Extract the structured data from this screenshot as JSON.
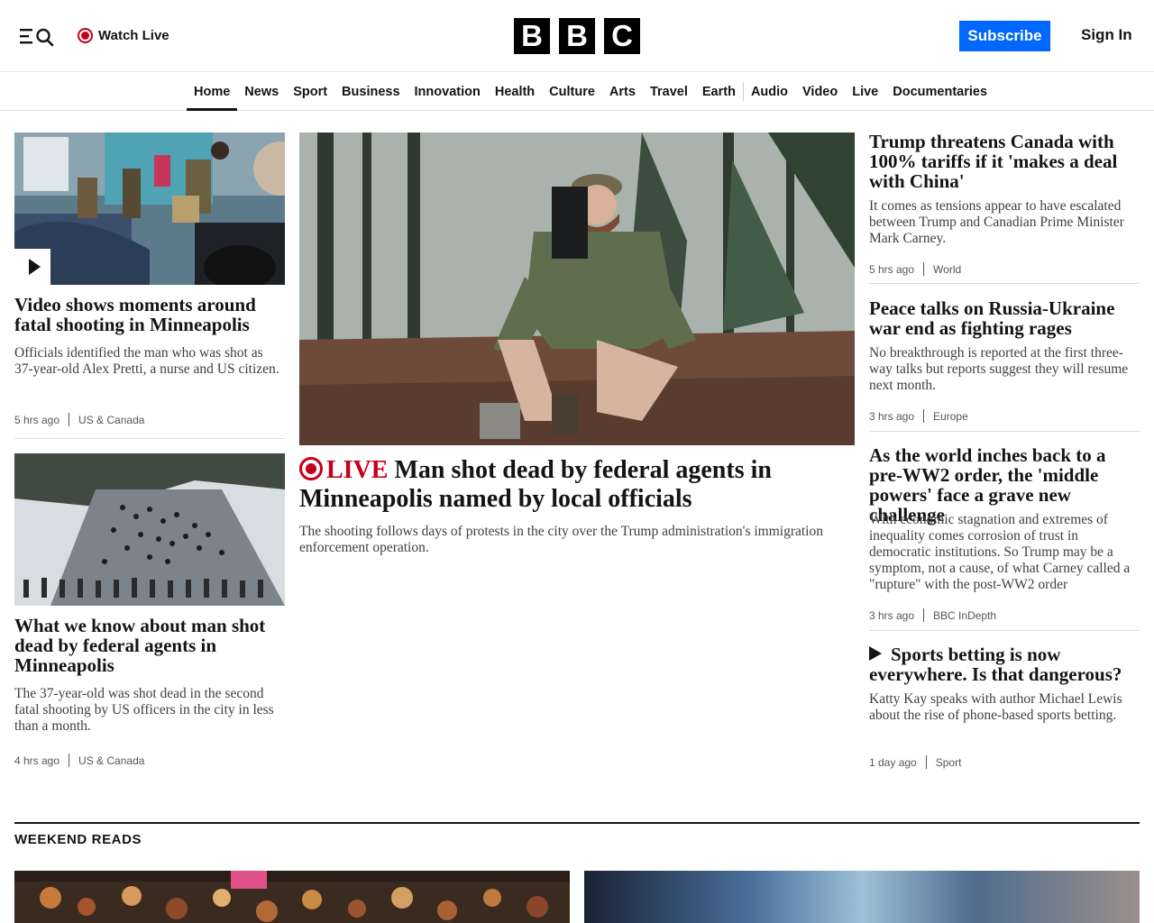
{
  "header": {
    "watch_live": "Watch Live",
    "logo_letters": [
      "B",
      "B",
      "C"
    ],
    "subscribe": "Subscribe",
    "sign_in": "Sign In"
  },
  "nav": {
    "items": [
      "Home",
      "News",
      "Sport",
      "Business",
      "Innovation",
      "Health",
      "Culture",
      "Arts",
      "Travel",
      "Earth",
      "Audio",
      "Video",
      "Live",
      "Documentaries"
    ],
    "active": "Home"
  },
  "left_stories": [
    {
      "headline": "Video shows moments around fatal shooting in Minneapolis",
      "summary": "Officials identified the man who was shot as 37-year-old Alex Pretti, a nurse and US citizen.",
      "time": "5 hrs ago",
      "section": "US & Canada"
    },
    {
      "headline": "What we know about man shot dead by federal agents in Minneapolis",
      "summary": "The 37-year-old was shot dead in the second fatal shooting by US officers in the city in less than a month.",
      "time": "4 hrs ago",
      "section": "US & Canada"
    }
  ],
  "lead_story": {
    "live_label": "LIVE",
    "headline": "Man shot dead by federal agents in Minneapolis named by local officials",
    "summary": "The shooting follows days of protests in the city over the Trump administration's immigration enforcement operation."
  },
  "right_stories": [
    {
      "headline": "Trump threatens Canada with 100% tariffs if it 'makes a deal with China'",
      "summary": "It comes as tensions appear to have escalated between Trump and Canadian Prime Minister Mark Carney.",
      "time": "5 hrs ago",
      "section": "World"
    },
    {
      "headline": "Peace talks on Russia-Ukraine war end as fighting rages",
      "summary": "No breakthrough is reported at the first three-way talks but reports suggest they will resume next month.",
      "time": "3 hrs ago",
      "section": "Europe"
    },
    {
      "headline": "As the world inches back to a pre-WW2 order, the 'middle powers' face a grave new challenge",
      "summary": "With economic stagnation and extremes of inequality comes corrosion of trust in democratic institutions. So Trump may be a symptom, not a cause, of what Carney called a \"rupture\" with the post-WW2 order",
      "time": "3 hrs ago",
      "section": "BBC InDepth"
    },
    {
      "headline": "Sports betting is now everywhere. Is that dangerous?",
      "summary": "Katty Kay speaks with author Michael Lewis about the rise of phone-based sports betting.",
      "time": "1 day ago",
      "section": "Sport"
    }
  ],
  "weekend": {
    "title": "WEEKEND READS"
  },
  "colors": {
    "live_red": "#c4001a",
    "subscribe_blue": "#0068ff"
  }
}
